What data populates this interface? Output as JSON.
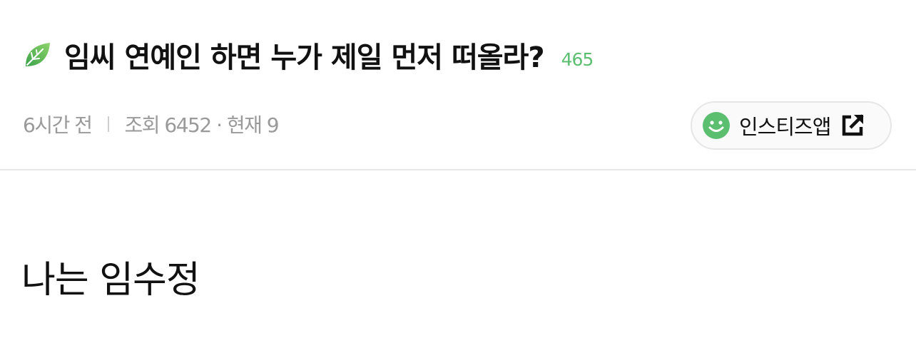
{
  "post": {
    "title": "임씨 연예인 하면 누가 제일 먼저 떠올라?",
    "comment_count": "465",
    "body": "나는 임수정"
  },
  "meta": {
    "time_ago": "6시간 전",
    "views": "조회 6452 · 현재 9"
  },
  "app_button": {
    "label": "인스티즈앱"
  },
  "icons": {
    "title_icon": "leaf-icon",
    "app_icon": "smile-icon",
    "open_icon": "external-link-icon"
  },
  "colors": {
    "accent_green": "#5cbf70",
    "meta_gray": "#9a9a9a",
    "text": "#111111"
  }
}
